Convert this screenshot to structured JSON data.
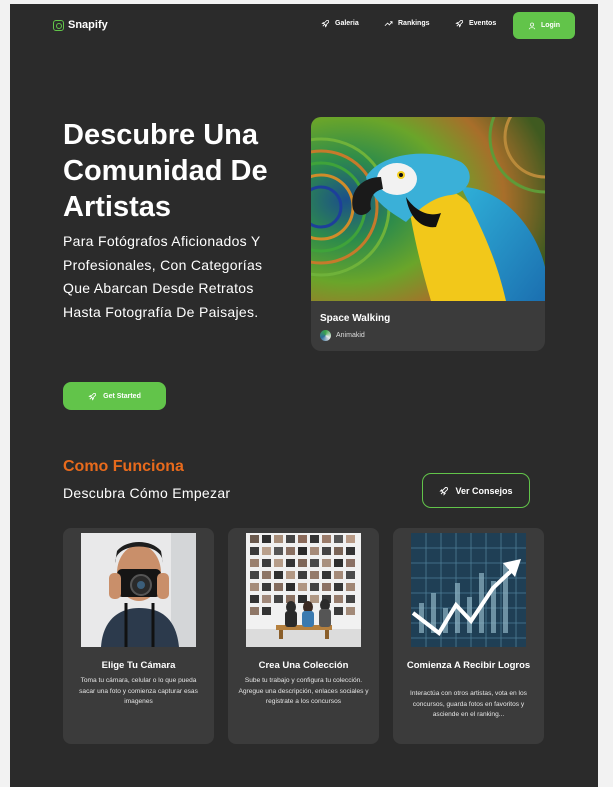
{
  "brand": {
    "name": "Snapify"
  },
  "nav": {
    "links": [
      {
        "label": "Galeria",
        "icon": "rocket-icon"
      },
      {
        "label": "Rankings",
        "icon": "trend-icon"
      },
      {
        "label": "Eventos",
        "icon": "rocket-icon"
      }
    ],
    "login_label": "Login"
  },
  "hero": {
    "title": "Descubre Una Comunidad De Artistas",
    "subtitle": "Para Fotógrafos Aficionados Y Profesionales, Con Categorías Que Abarcan Desde Retratos Hasta Fotografía De Paisajes.",
    "card": {
      "title": "Space Walking",
      "author": "Animakid"
    },
    "cta_label": "Get Started"
  },
  "how": {
    "title": "Como Funciona",
    "subtitle": "Descubra Cómo Empezar",
    "tips_label": "Ver Consejos",
    "steps": [
      {
        "title": "Elige Tu Cámara",
        "text": "Toma tu cámara, celular o lo que pueda sacar una foto y comienza capturar esas imagenes"
      },
      {
        "title": "Crea Una Colección",
        "text": "Sube tu trabajo y configura tu colección. Agregue una descripción, enlaces sociales y registrate a los  concursos"
      },
      {
        "title": "Comienza A Recibir Logros",
        "text": "Interactúa con otros artistas, vota en los concursos, guarda fotos en favoritos y asciende en el ranking..."
      }
    ]
  },
  "colors": {
    "accent": "#62c44a",
    "orange": "#e86a1c",
    "background": "#2b2b2b",
    "card": "#3b3b3b"
  }
}
